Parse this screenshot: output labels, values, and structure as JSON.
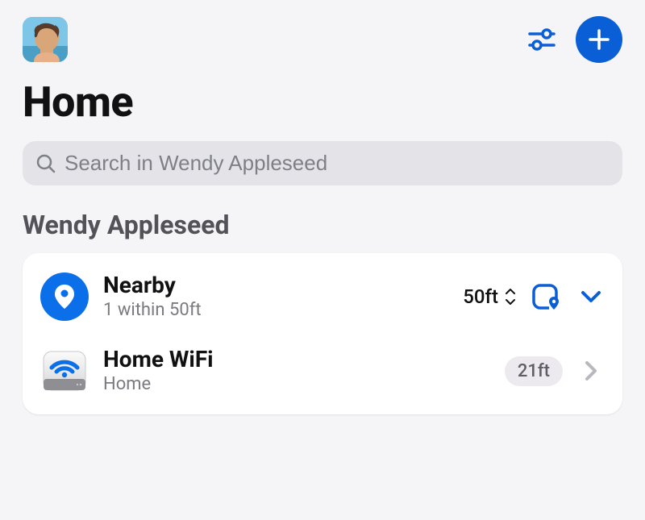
{
  "header": {
    "title": "Home"
  },
  "search": {
    "placeholder": "Search in Wendy Appleseed"
  },
  "section": {
    "title": "Wendy Appleseed"
  },
  "rows": {
    "nearby": {
      "title": "Nearby",
      "subtitle": "1 within 50ft",
      "distance": "50ft"
    },
    "wifi": {
      "title": "Home WiFi",
      "subtitle": "Home",
      "distance": "21ft"
    }
  },
  "colors": {
    "accent": "#0a5fd6"
  }
}
